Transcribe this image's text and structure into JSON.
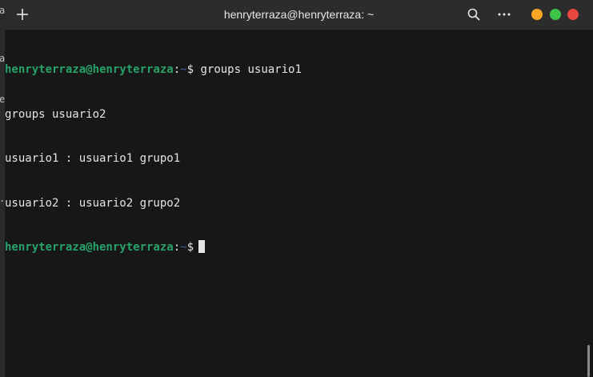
{
  "window": {
    "title": "henryterraza@henryterraza: ~"
  },
  "background_fragments": [
    "a",
    "a",
    "e",
    "."
  ],
  "prompt": {
    "user_host": "henryterraza@henryterraza",
    "colon": ":",
    "path": "~",
    "symbol": "$"
  },
  "lines": [
    {
      "type": "prompt",
      "command": " groups usuario1"
    },
    {
      "type": "output",
      "text": "groups usuario2"
    },
    {
      "type": "output",
      "text": "usuario1 : usuario1 grupo1"
    },
    {
      "type": "output",
      "text": "usuario2 : usuario2 grupo2"
    },
    {
      "type": "prompt",
      "command": ""
    }
  ],
  "icons": {
    "new_tab": "plus-icon",
    "search": "search-icon",
    "menu": "ellipsis-icon"
  },
  "colors": {
    "prompt_user_host": "#26a269",
    "prompt_path": "#3465a4",
    "text": "#e4e4e4",
    "cursor": "#e4e4e4",
    "minimize": "#f6a623",
    "maximize": "#3cc34a",
    "close": "#e8473d"
  }
}
